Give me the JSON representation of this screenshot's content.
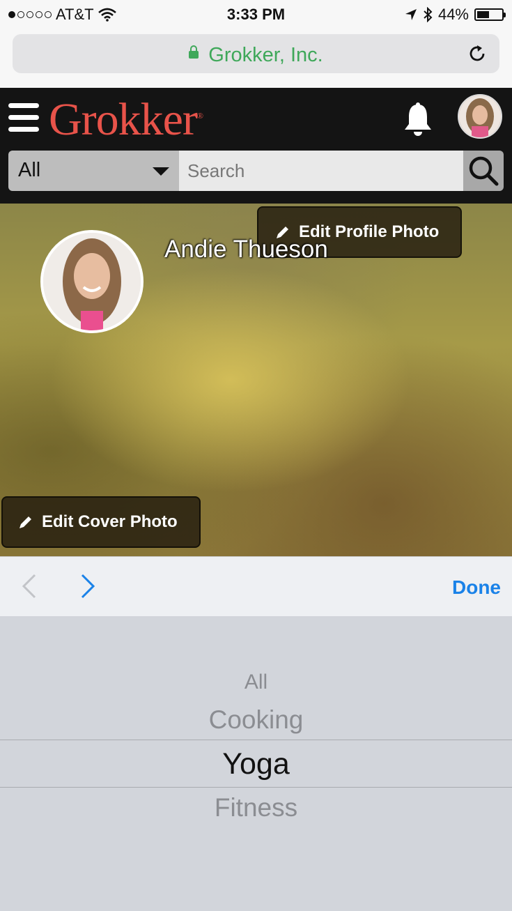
{
  "status_bar": {
    "carrier": "AT&T",
    "time": "3:33 PM",
    "battery": "44%",
    "icons": [
      "signal-dots-icon",
      "wifi-icon",
      "location-arrow-icon",
      "bluetooth-icon",
      "battery-icon"
    ]
  },
  "browser": {
    "site_name": "Grokker, Inc.",
    "icons": [
      "lock-icon",
      "reload-icon"
    ]
  },
  "header": {
    "logo_text": "Grokker",
    "category_value": "All",
    "search_placeholder": "Search",
    "icons": [
      "menu-icon",
      "bell-icon",
      "search-icon"
    ]
  },
  "profile": {
    "name": "Andie Thueson",
    "edit_profile_photo_label": "Edit Profile Photo",
    "edit_cover_photo_label": "Edit Cover Photo"
  },
  "accessory": {
    "done_label": "Done"
  },
  "picker": {
    "options": [
      "All",
      "Cooking",
      "Yoga",
      "Fitness"
    ],
    "selected": "Yoga"
  },
  "colors": {
    "brand_red": "#e8534a",
    "url_green": "#3fa85a",
    "ios_blue": "#1a82e8",
    "header_bg": "#141414"
  }
}
